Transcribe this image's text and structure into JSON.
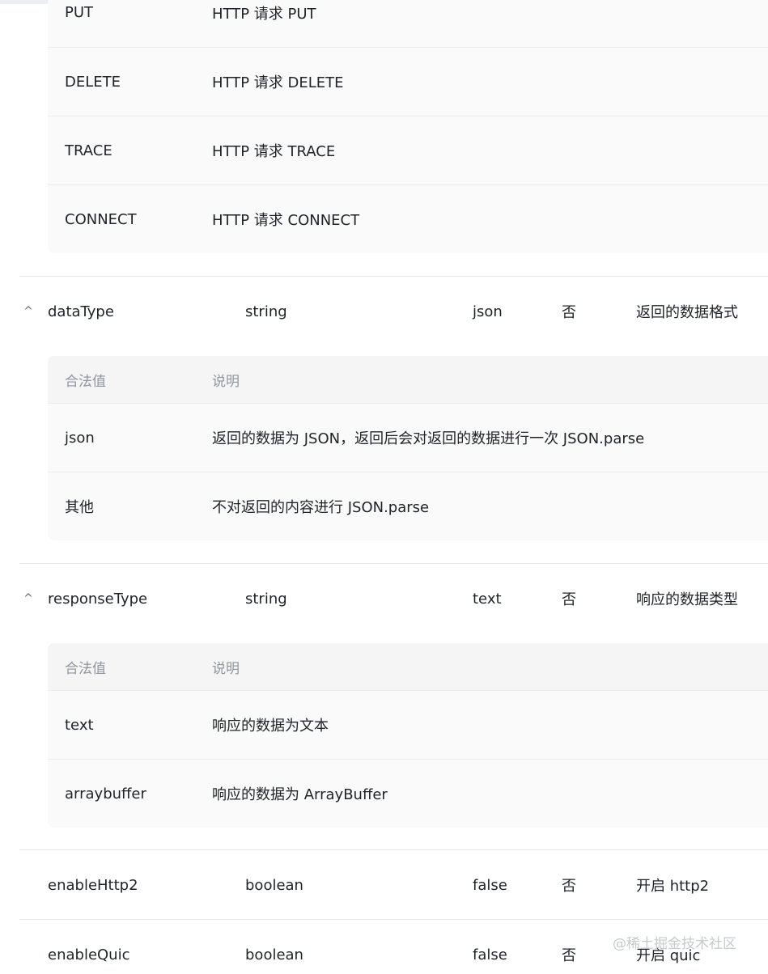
{
  "method_values": [
    {
      "value": "PUT",
      "desc": "HTTP 请求 PUT"
    },
    {
      "value": "DELETE",
      "desc": "HTTP 请求 DELETE"
    },
    {
      "value": "TRACE",
      "desc": "HTTP 请求 TRACE"
    },
    {
      "value": "CONNECT",
      "desc": "HTTP 请求 CONNECT"
    }
  ],
  "params": {
    "dataType": {
      "toggle": "^",
      "name": "dataType",
      "type": "string",
      "default": "json",
      "required": "否",
      "desc": "返回的数据格式",
      "header": {
        "value": "合法值",
        "desc": "说明"
      },
      "values": [
        {
          "value": "json",
          "desc": "返回的数据为 JSON，返回后会对返回的数据进行一次 JSON.parse"
        },
        {
          "value": "其他",
          "desc": "不对返回的内容进行 JSON.parse"
        }
      ]
    },
    "responseType": {
      "toggle": "^",
      "name": "responseType",
      "type": "string",
      "default": "text",
      "required": "否",
      "desc": "响应的数据类型",
      "header": {
        "value": "合法值",
        "desc": "说明"
      },
      "values": [
        {
          "value": "text",
          "desc": "响应的数据为文本"
        },
        {
          "value": "arraybuffer",
          "desc": "响应的数据为 ArrayBuffer"
        }
      ]
    },
    "enableHttp2": {
      "name": "enableHttp2",
      "type": "boolean",
      "default": "false",
      "required": "否",
      "desc": "开启 http2"
    },
    "enableQuic": {
      "name": "enableQuic",
      "type": "boolean",
      "default": "false",
      "required": "否",
      "desc": "开启 quic"
    }
  },
  "watermark": "@稀土掘金技术社区"
}
